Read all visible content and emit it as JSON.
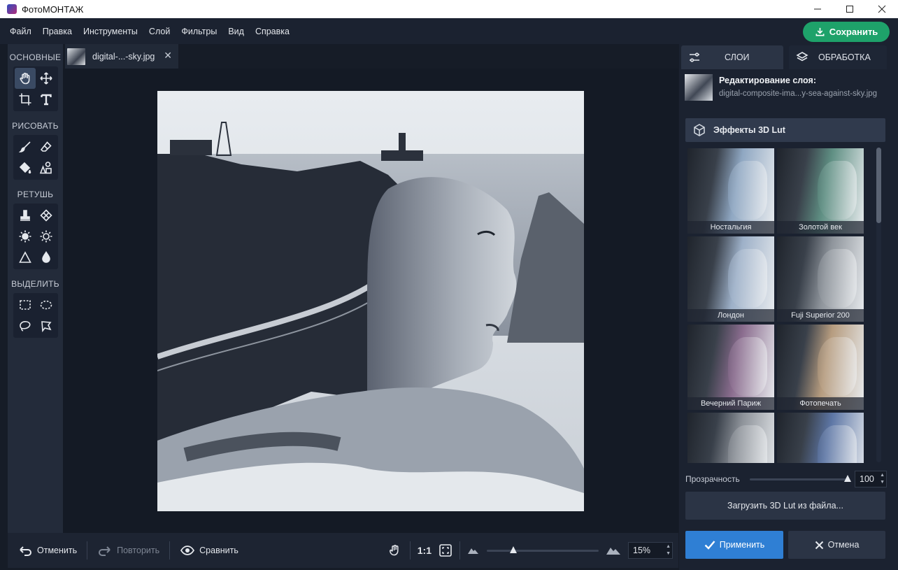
{
  "app": {
    "title": "ФотоМОНТАЖ",
    "window_controls": [
      "minimize-icon",
      "maximize-icon",
      "close-icon"
    ]
  },
  "menu": {
    "items": [
      "Файл",
      "Правка",
      "Инструменты",
      "Слой",
      "Фильтры",
      "Вид",
      "Справка"
    ],
    "save_label": "Сохранить"
  },
  "tools": {
    "sections": [
      {
        "title": "ОСНОВНЫЕ",
        "tools": [
          "hand-icon",
          "move-icon",
          "crop-icon",
          "text-icon"
        ],
        "active": "hand-icon"
      },
      {
        "title": "РИСОВАТЬ",
        "tools": [
          "brush-icon",
          "eraser-icon",
          "fill-bucket-icon",
          "shapes-icon"
        ]
      },
      {
        "title": "РЕТУШЬ",
        "tools": [
          "stamp-icon",
          "patch-icon",
          "brighten-icon",
          "darken-icon",
          "sharpen-icon",
          "blur-drop-icon"
        ]
      },
      {
        "title": "ВЫДЕЛИТЬ",
        "tools": [
          "rect-select-icon",
          "ellipse-select-icon",
          "lasso-icon",
          "polygon-lasso-icon"
        ]
      }
    ]
  },
  "document": {
    "tab_name": "digital-...-sky.jpg"
  },
  "bottom_bar": {
    "undo_label": "Отменить",
    "redo_label": "Повторить",
    "compare_label": "Сравнить",
    "ratio_label": "1:1",
    "zoom_value": "15%",
    "zoom_level_fraction": 0.24
  },
  "panel": {
    "tabs": [
      {
        "label": "СЛОИ",
        "icon": "sliders-icon"
      },
      {
        "label": "ОБРАБОТКА",
        "icon": "layers-icon"
      }
    ],
    "layer_title": "Редактирование слоя:",
    "layer_file": "digital-composite-ima...y-sea-against-sky.jpg",
    "effects_title": "Эффекты 3D Lut",
    "luts": [
      {
        "label": "Ностальгия",
        "tint": "#8fa7c2"
      },
      {
        "label": "Золотой век",
        "tint": "#5f8f83"
      },
      {
        "label": "Лондон",
        "tint": "#9db0c8"
      },
      {
        "label": "Fuji Superior 200",
        "tint": "#8e949b"
      },
      {
        "label": "Вечерний Париж",
        "tint": "#8a6c8e"
      },
      {
        "label": "Фотопечать",
        "tint": "#b69c7f"
      },
      {
        "label": "",
        "tint": "#8d9299"
      },
      {
        "label": "",
        "tint": "#5d76a5"
      }
    ],
    "opacity_label": "Прозрачность",
    "opacity_value": "100",
    "opacity_fraction": 1.0,
    "load_lut_label": "Загрузить 3D Lut из файла...",
    "apply_label": "Применить",
    "cancel_label": "Отмена"
  }
}
